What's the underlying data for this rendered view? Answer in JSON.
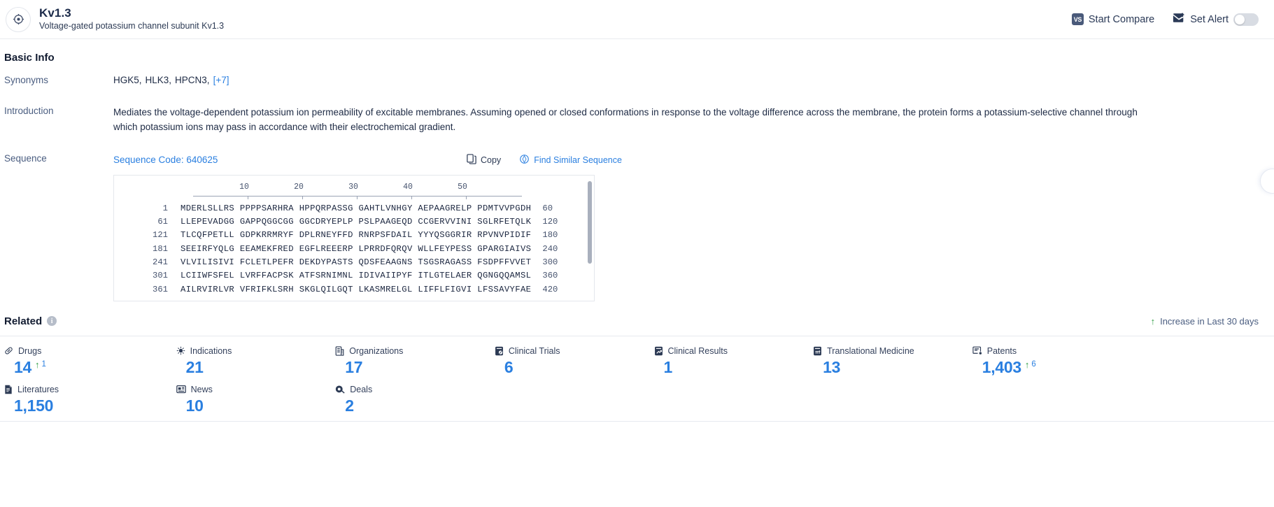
{
  "header": {
    "logo_icon": "target-crosshair-icon",
    "title": "Kv1.3",
    "subtitle": "Voltage-gated potassium channel subunit Kv1.3",
    "compare": {
      "badge": "VS",
      "label": "Start Compare"
    },
    "alert": {
      "icon": "alert-envelope-icon",
      "label": "Set Alert",
      "toggle_state": "off"
    }
  },
  "basic_info": {
    "title": "Basic Info",
    "synonyms": {
      "label": "Synonyms",
      "items": [
        "HGK5,",
        "HLK3,",
        "HPCN3,"
      ],
      "more": "[+7]"
    },
    "introduction": {
      "label": "Introduction",
      "text": "Mediates the voltage-dependent potassium ion permeability of excitable membranes. Assuming opened or closed conformations in response to the voltage difference across the membrane, the protein forms a potassium-selective channel through which potassium ions may pass in accordance with their electrochemical gradient."
    },
    "sequence": {
      "label": "Sequence",
      "code_label": "Sequence Code: 640625",
      "copy_label": "Copy",
      "copy_icon": "copy-icon",
      "find_label": "Find Similar Sequence",
      "find_icon": "find-similar-icon",
      "ruler_ticks": [
        "10",
        "20",
        "30",
        "40",
        "50"
      ],
      "rows": [
        {
          "start": "1",
          "chunks": "MDERLSLLRS PPPPSARHRA HPPQRPASSG GAHTLVNHGY AEPAAGRELP PDMTVVPGDH",
          "end": "60"
        },
        {
          "start": "61",
          "chunks": "LLEPEVADGG GAPPQGGCGG GGCDRYEPLP PSLPAAGEQD CCGERVVINI SGLRFETQLK",
          "end": "120"
        },
        {
          "start": "121",
          "chunks": "TLCQFPETLL GDPKRRMRYF DPLRNEYFFD RNRPSFDAIL YYYQSGGRIR RPVNVPIDIF",
          "end": "180"
        },
        {
          "start": "181",
          "chunks": "SEEIRFYQLG EEAMEKFRED EGFLREEERP LPRRDFQRQV WLLFEYPESS GPARGIAIVS",
          "end": "240"
        },
        {
          "start": "241",
          "chunks": "VLVILISIVI FCLETLPEFR DEKDYPASTS QDSFEAAGNS TSGSRAGASS FSDPFFVVET",
          "end": "300"
        },
        {
          "start": "301",
          "chunks": "LCIIWFSFEL LVRFFACPSK ATFSRNIMNL IDIVAIIPYF ITLGTELAER QGNGQQAMSL",
          "end": "360"
        },
        {
          "start": "361",
          "chunks": "AILRVIRLVR VFRIFKLSRH SKGLQILGQT LKASMRELGL LIFFLFIGVI LFSSAVYFAE",
          "end": "420"
        }
      ]
    }
  },
  "related": {
    "title": "Related",
    "info_icon": "info-icon",
    "legend_arrow": "↑",
    "legend_label": "Increase in Last 30 days",
    "stats": [
      {
        "icon": "pill-icon",
        "label": "Drugs",
        "value": "14",
        "delta": "1"
      },
      {
        "icon": "virus-icon",
        "label": "Indications",
        "value": "21",
        "delta": ""
      },
      {
        "icon": "building-icon",
        "label": "Organizations",
        "value": "17",
        "delta": ""
      },
      {
        "icon": "clinical-trial-icon",
        "label": "Clinical Trials",
        "value": "6",
        "delta": ""
      },
      {
        "icon": "clinical-result-icon",
        "label": "Clinical Results",
        "value": "1",
        "delta": ""
      },
      {
        "icon": "translational-icon",
        "label": "Translational Medicine",
        "value": "13",
        "delta": ""
      },
      {
        "icon": "patent-icon",
        "label": "Patents",
        "value": "1,403",
        "delta": "6"
      },
      {
        "icon": "literature-icon",
        "label": "Literatures",
        "value": "1,150",
        "delta": ""
      },
      {
        "icon": "news-icon",
        "label": "News",
        "value": "10",
        "delta": ""
      },
      {
        "icon": "deals-icon",
        "label": "Deals",
        "value": "2",
        "delta": ""
      }
    ]
  },
  "colors": {
    "accent": "#2a7fe0",
    "increase": "#2f9e44",
    "text_dark": "#1d2a44",
    "label": "#4a5d80"
  }
}
